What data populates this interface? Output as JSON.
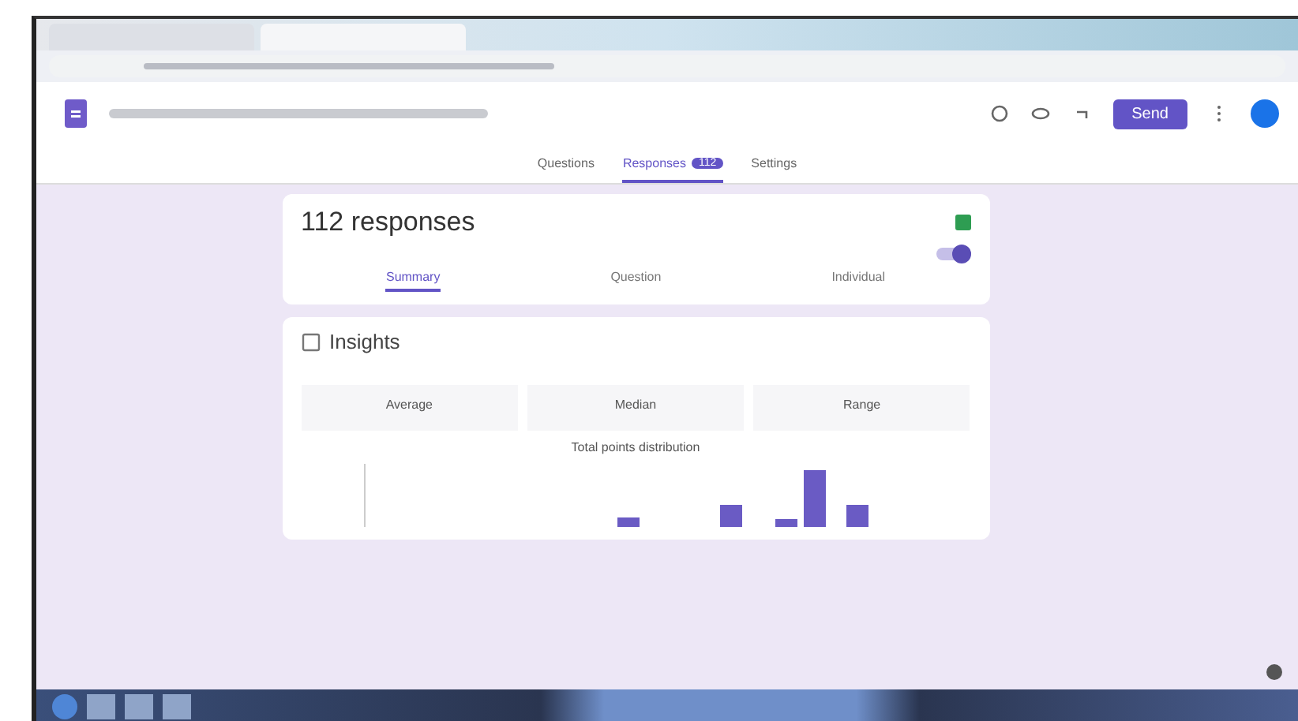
{
  "form_header": {
    "send_button": "Send"
  },
  "nav_tabs": [
    {
      "label": "Questions",
      "selected": false
    },
    {
      "label": "Responses",
      "selected": true,
      "badge": "112"
    },
    {
      "label": "Settings",
      "selected": false
    }
  ],
  "responses_card": {
    "title": "112 responses",
    "accepting_toggle": {
      "on": true
    },
    "tabs": [
      {
        "label": "Summary",
        "selected": true
      },
      {
        "label": "Question",
        "selected": false
      },
      {
        "label": "Individual",
        "selected": false
      }
    ]
  },
  "insights": {
    "title": "Insights",
    "stats": [
      {
        "label": "Average"
      },
      {
        "label": "Median"
      },
      {
        "label": "Range"
      }
    ],
    "chart_title": "Total points distribution"
  }
}
